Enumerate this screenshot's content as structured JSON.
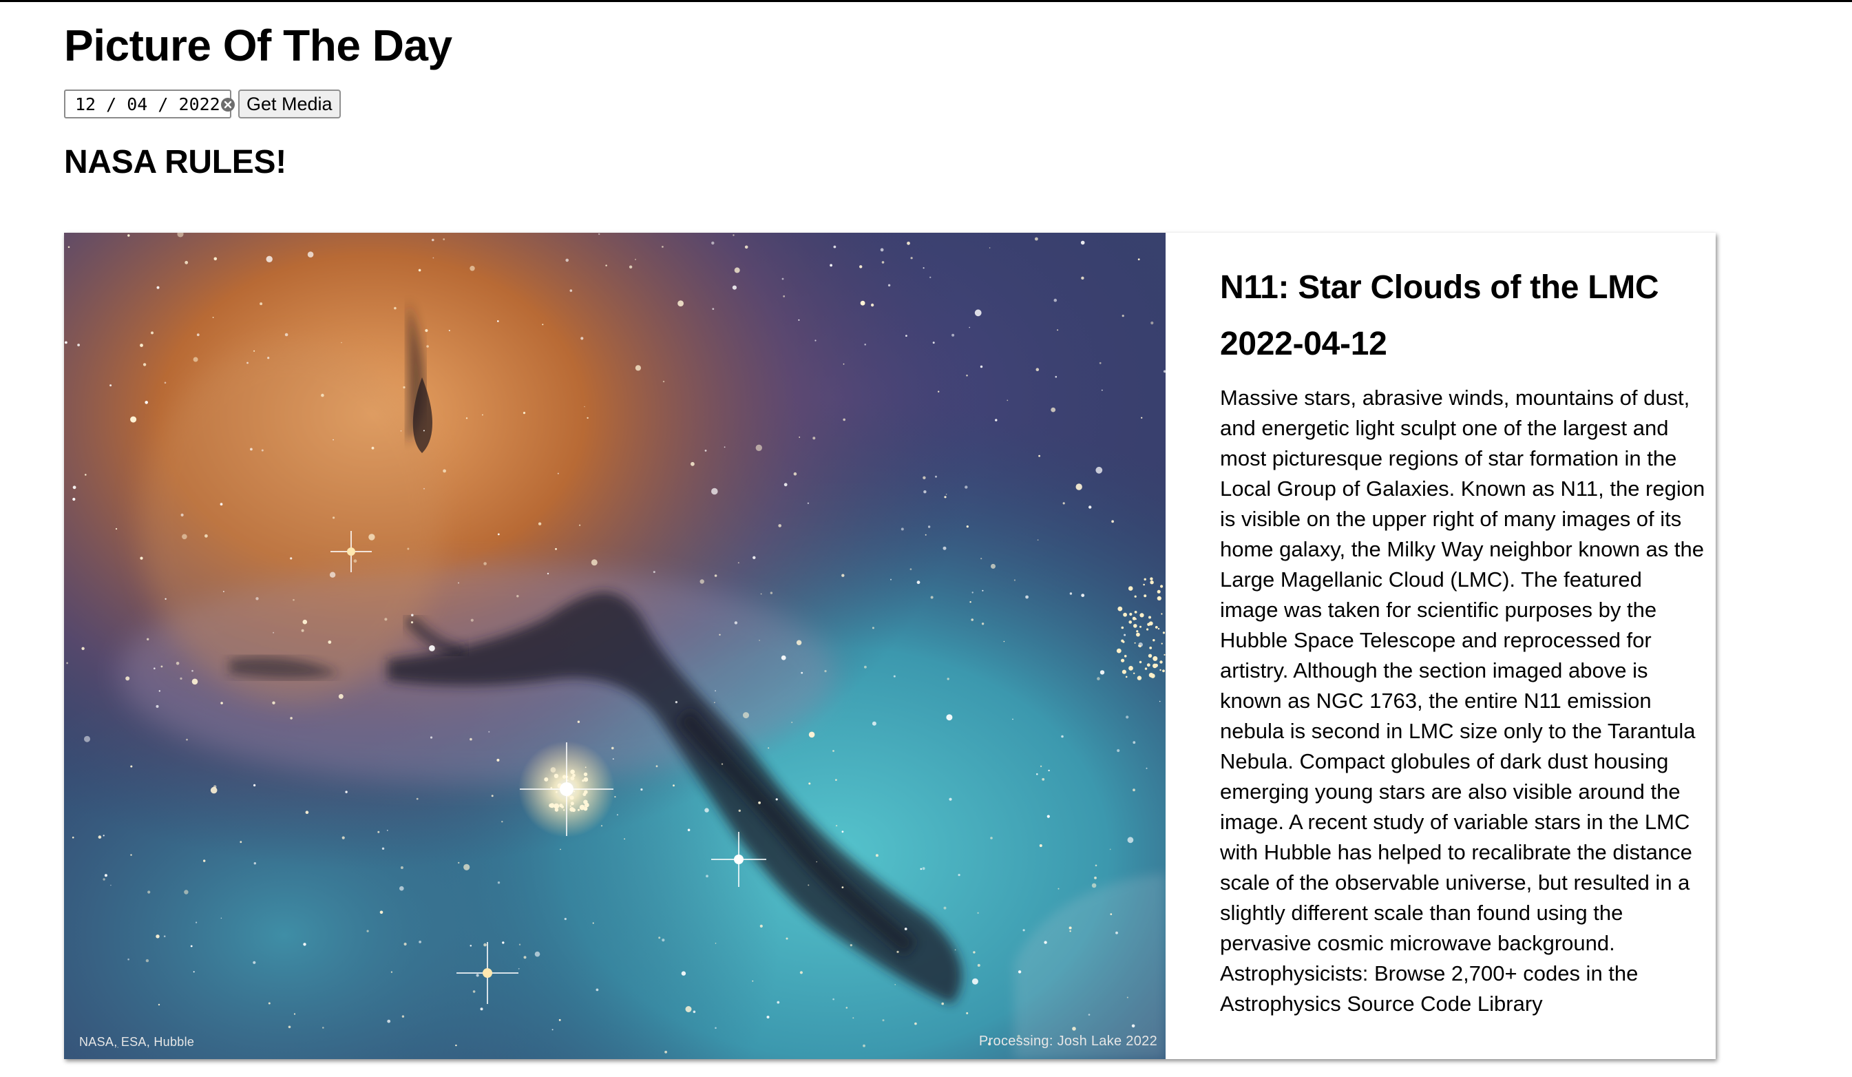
{
  "page": {
    "title": "Picture Of The Day",
    "subtitle": "NASA RULES!"
  },
  "controls": {
    "date_value": "12 / 04 / 2022",
    "clear_icon": "circle-x-icon",
    "get_media_label": "Get Media"
  },
  "apod": {
    "title": "N11: Star Clouds of the LMC",
    "date": "2022-04-12",
    "explanation": "Massive stars, abrasive winds, mountains of dust, and energetic light sculpt one of the largest and most picturesque regions of star formation in the Local Group of Galaxies. Known as N11, the region is visible on the upper right of many images of its home galaxy, the Milky Way neighbor known as the Large Magellanic Cloud (LMC). The featured image was taken for scientific purposes by the Hubble Space Telescope and reprocessed for artistry. Although the section imaged above is known as NGC 1763, the entire N11 emission nebula is second in LMC size only to the Tarantula Nebula. Compact globules of dark dust housing emerging young stars are also visible around the image. A recent study of variable stars in the LMC with Hubble has helped to recalibrate the distance scale of the observable universe, but resulted in a slightly different scale than found using the pervasive cosmic microwave background. Astrophysicists: Browse 2,700+ codes in the Astrophysics Source Code Library",
    "image_credit_left": "NASA, ESA, Hubble",
    "image_credit_right": "Processing: Josh Lake 2022"
  },
  "colors": {
    "nebula_orange": "#c9793a",
    "nebula_teal": "#3fa3b0",
    "nebula_purple": "#5a4a78",
    "dust_dark": "#1e1a2a"
  }
}
